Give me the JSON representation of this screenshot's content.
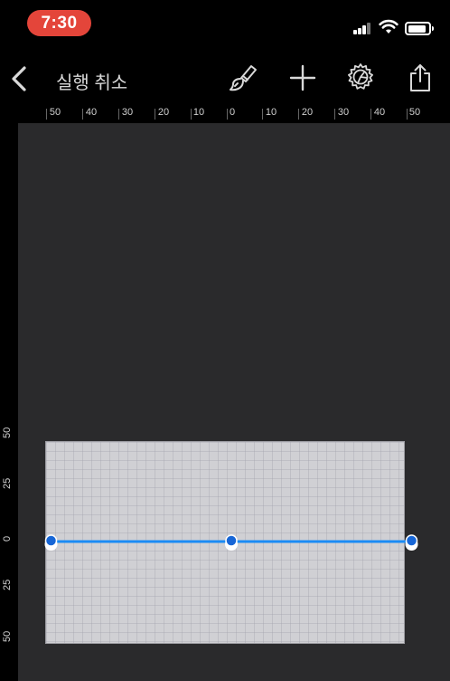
{
  "status_bar": {
    "time": "7:30",
    "time_pill_color": "#e4453a"
  },
  "nav": {
    "back_icon": "chevron-left-icon",
    "title": "실행 취소",
    "icons": [
      "paintbrush-icon",
      "plus-icon",
      "gear-icon",
      "share-icon"
    ]
  },
  "h_ruler": {
    "labels": [
      "50",
      "40",
      "30",
      "20",
      "10",
      "0",
      "10",
      "20",
      "30",
      "40",
      "50"
    ]
  },
  "v_ruler": {
    "labels": [
      "50",
      "25",
      "0",
      "25",
      "50"
    ]
  },
  "curve": {
    "color": "#1a8bf5",
    "handle_color": "#1766d6",
    "points": [
      {
        "x": -50,
        "y": 0
      },
      {
        "x": 0,
        "y": 0
      },
      {
        "x": 50,
        "y": 0
      }
    ]
  }
}
